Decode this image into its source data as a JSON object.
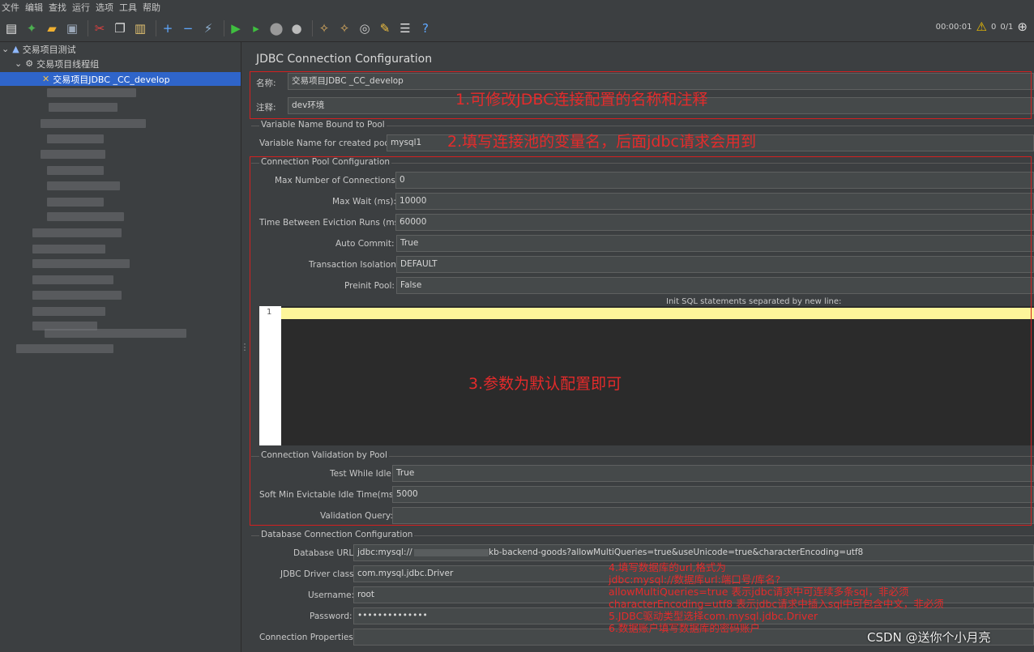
{
  "menu": [
    "文件",
    "编辑",
    "查找",
    "运行",
    "选项",
    "工具",
    "帮助"
  ],
  "toolbar_status": {
    "timer": "00:00:01",
    "warnings": "0",
    "threads": "0/1"
  },
  "tree": {
    "root": "交易项目测试",
    "group": "交易项目线程组",
    "selected": "交易项目JDBC _CC_develop"
  },
  "panel": {
    "title": "JDBC Connection Configuration",
    "name_label": "名称:",
    "name_value": "交易项目JDBC _CC_develop",
    "comment_label": "注释:",
    "comment_value": "dev环境",
    "var_group": "Variable Name Bound to Pool",
    "var_label": "Variable Name for created pool:",
    "var_value": "mysql1",
    "pool_group": "Connection Pool Configuration",
    "max_conn_label": "Max Number of Connections:",
    "max_conn_value": "0",
    "max_wait_label": "Max Wait (ms):",
    "max_wait_value": "10000",
    "eviction_label": "Time Between Eviction Runs (ms):",
    "eviction_value": "60000",
    "autocommit_label": "Auto Commit:",
    "autocommit_value": "True",
    "isolation_label": "Transaction Isolation:",
    "isolation_value": "DEFAULT",
    "preinit_label": "Preinit Pool:",
    "preinit_value": "False",
    "init_sql_label": "Init SQL statements separated by new line:",
    "line_number": "1",
    "validation_group": "Connection Validation by Pool",
    "test_idle_label": "Test While Idle:",
    "test_idle_value": "True",
    "soft_min_label": "Soft Min Evictable Idle Time(ms):",
    "soft_min_value": "5000",
    "validation_query_label": "Validation Query:",
    "validation_query_value": "",
    "db_group": "Database Connection Configuration",
    "db_url_label": "Database URL:",
    "db_url_value": "jdbc:mysql://",
    "db_url_tail": "kb-backend-goods?allowMultiQueries=true&useUnicode=true&characterEncoding=utf8",
    "driver_label": "JDBC Driver class:",
    "driver_value": "com.mysql.jdbc.Driver",
    "username_label": "Username:",
    "username_value": "root",
    "password_label": "Password:",
    "password_value": "••••••••••••••",
    "props_label": "Connection Properties:",
    "props_value": ""
  },
  "annotations": {
    "a1": "1.可修改JDBC连接配置的名称和注释",
    "a2": "2.填写连接池的变量名，后面jdbc请求会用到",
    "a3": "3.参数为默认配置即可",
    "a4": [
      "4.填写数据库的url,格式为",
      "jdbc:mysql://数据库url:端口号/库名?",
      "allowMultiQueries=true 表示jdbc请求中可连续多条sql，非必须",
      "characterEncoding=utf8 表示jdbc请求中插入sql中可包含中文，非必须",
      "5.JDBC驱动类型选择com.mysql.jdbc.Driver",
      "6.数据账户填写数据库的密码账户"
    ]
  },
  "watermark": "CSDN @送你个小月亮"
}
